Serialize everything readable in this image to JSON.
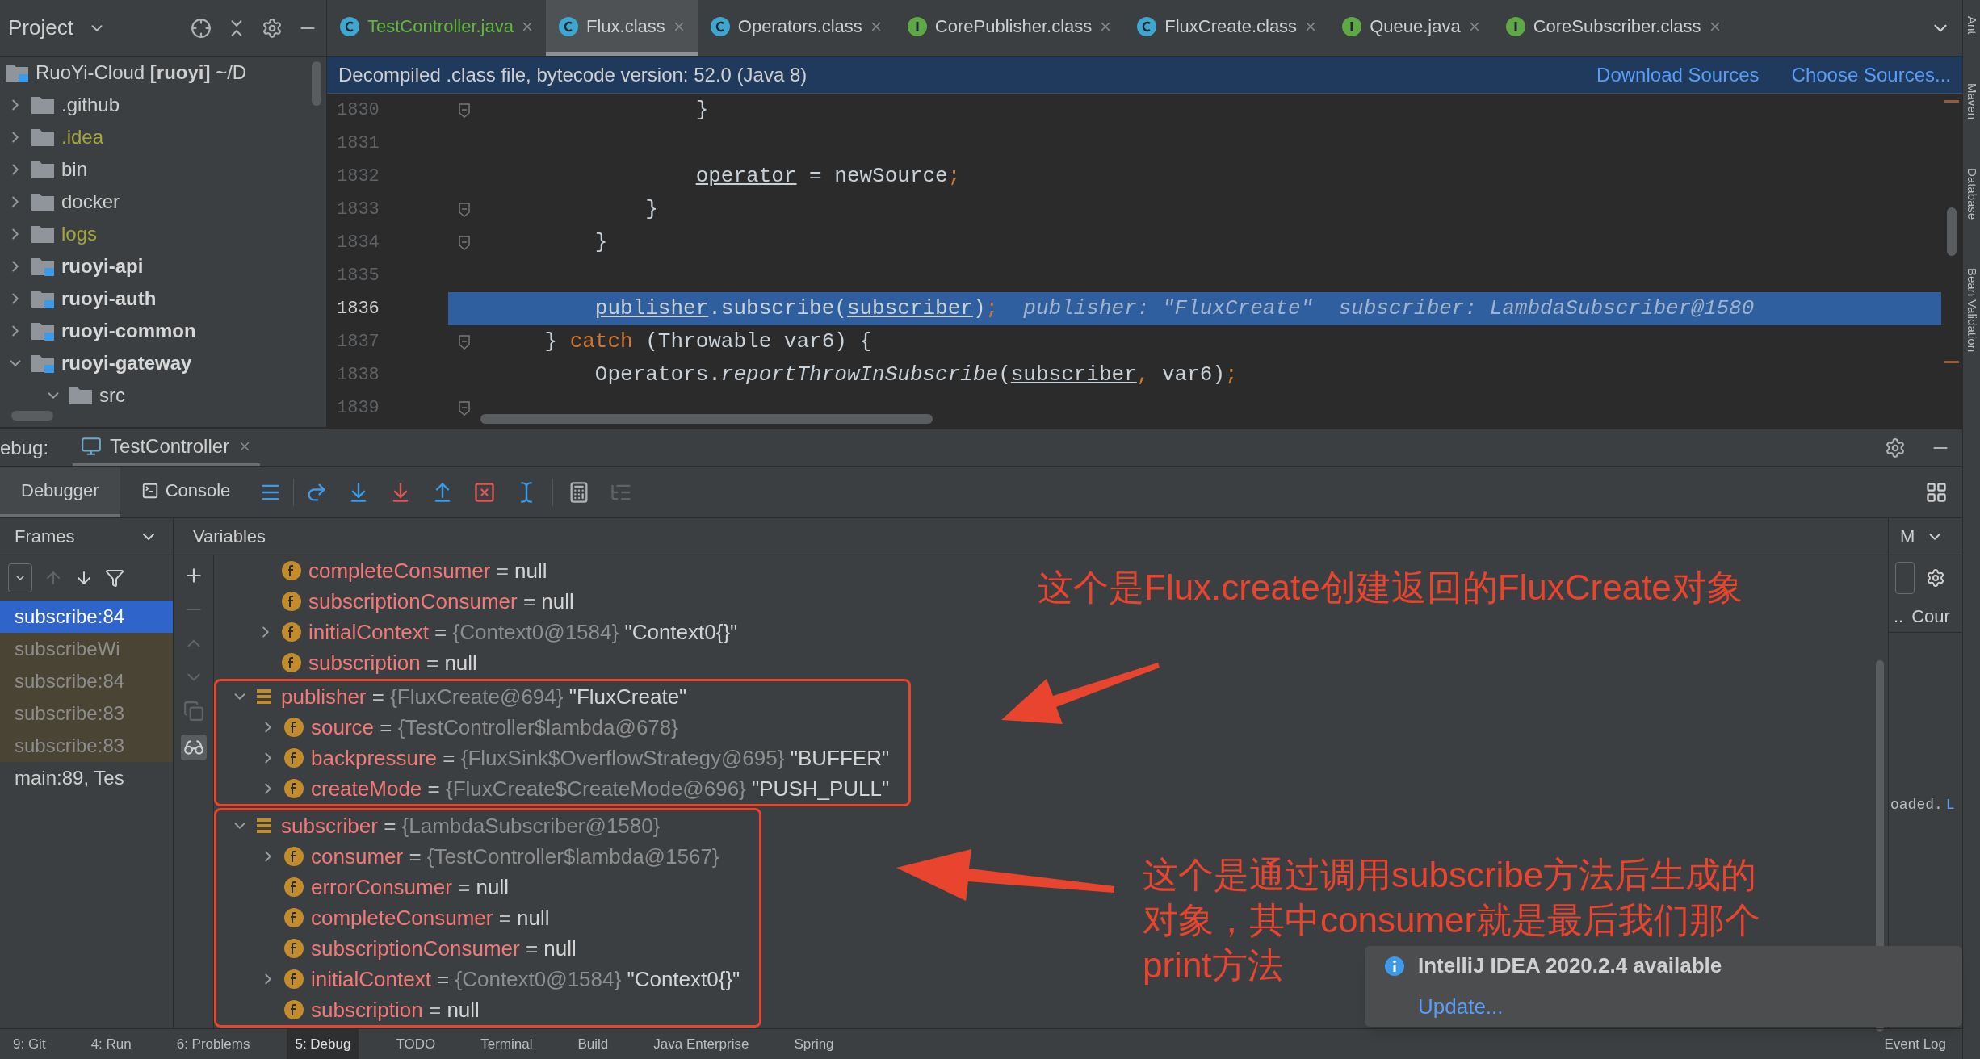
{
  "project_panel": {
    "title": "Project",
    "tree": [
      {
        "label": "RuoYi-Cloud **[ruoyi]** ~/D",
        "kind": "project",
        "children": [
          {
            "label": ".github",
            "kind": "folder",
            "expanded": false
          },
          {
            "label": ".idea",
            "kind": "ignored",
            "expanded": false
          },
          {
            "label": "bin",
            "kind": "folder",
            "expanded": false
          },
          {
            "label": "docker",
            "kind": "folder",
            "expanded": false
          },
          {
            "label": "logs",
            "kind": "ignored",
            "expanded": false
          },
          {
            "label": "ruoyi-api",
            "kind": "module",
            "expanded": false
          },
          {
            "label": "ruoyi-auth",
            "kind": "module",
            "expanded": false
          },
          {
            "label": "ruoyi-common",
            "kind": "module",
            "expanded": false
          },
          {
            "label": "ruoyi-gateway",
            "kind": "module",
            "expanded": true,
            "children": [
              {
                "label": "src",
                "kind": "folder",
                "expanded": true
              }
            ]
          }
        ]
      }
    ]
  },
  "editor": {
    "tabs": [
      {
        "label": "TestController.java",
        "kind": "class",
        "added": true,
        "selected": false
      },
      {
        "label": "Flux.class",
        "kind": "class",
        "added": false,
        "selected": true
      },
      {
        "label": "Operators.class",
        "kind": "class",
        "added": false,
        "selected": false
      },
      {
        "label": "CorePublisher.class",
        "kind": "interface",
        "added": false,
        "selected": false
      },
      {
        "label": "FluxCreate.class",
        "kind": "class",
        "added": false,
        "selected": false
      },
      {
        "label": "Queue.java",
        "kind": "interface",
        "added": false,
        "selected": false
      },
      {
        "label": "CoreSubscriber.class",
        "kind": "interface",
        "added": false,
        "selected": false
      }
    ],
    "banner": {
      "text": "Decompiled .class file, bytecode version: 52.0 (Java 8)",
      "links": [
        "Download Sources",
        "Choose Sources..."
      ]
    },
    "lines": [
      {
        "number": "1830",
        "fold": true,
        "selected": false,
        "segments": [
          {
            "text": "                }",
            "kind": "plain"
          }
        ]
      },
      {
        "number": "1831",
        "fold": false,
        "selected": false
      },
      {
        "number": "1832",
        "fold": false,
        "selected": false,
        "segments": [
          {
            "text": "                operator",
            "kind": "field"
          },
          {
            "text": " = newSource",
            "kind": "plain"
          },
          {
            "text": ";",
            "kind": "punct"
          }
        ]
      },
      {
        "number": "1833",
        "fold": true,
        "selected": false,
        "segments": [
          {
            "text": "            }",
            "kind": "plain"
          }
        ]
      },
      {
        "number": "1834",
        "fold": true,
        "selected": false,
        "segments": [
          {
            "text": "        }",
            "kind": "plain"
          }
        ]
      },
      {
        "number": "1835",
        "fold": false,
        "selected": false
      },
      {
        "number": "1836",
        "fold": false,
        "selected": true,
        "segments": [
          {
            "text": "        publisher",
            "kind": "field"
          },
          {
            "text": ".subscribe(",
            "kind": "plain"
          },
          {
            "text": "subscriber",
            "kind": "field"
          },
          {
            "text": ")",
            "kind": "plain"
          },
          {
            "text": ";",
            "kind": "punct"
          },
          {
            "text": "  publisher: \"FluxCreate\"  subscriber: LambdaSubscriber@1580",
            "kind": "hint"
          }
        ]
      },
      {
        "number": "1837",
        "fold": true,
        "selected": false,
        "segments": [
          {
            "text": "    } ",
            "kind": "plain"
          },
          {
            "text": "catch",
            "kind": "keyword"
          },
          {
            "text": " (Throwable var6) {",
            "kind": "plain"
          }
        ]
      },
      {
        "number": "1838",
        "fold": false,
        "selected": false,
        "segments": [
          {
            "text": "        Operators.",
            "kind": "plain"
          },
          {
            "text": "reportThrowInSubscribe",
            "kind": "italic"
          },
          {
            "text": "(",
            "kind": "plain"
          },
          {
            "text": "subscriber",
            "kind": "field"
          },
          {
            "text": ",",
            "kind": "punct"
          },
          {
            "text": " var6)",
            "kind": "plain"
          },
          {
            "text": ";",
            "kind": "punct"
          }
        ]
      },
      {
        "number": "1839",
        "fold": true,
        "selected": false
      }
    ]
  },
  "side_strip": [
    "Ant",
    "Maven",
    "Database",
    "Bean Validation"
  ],
  "debug": {
    "label": "ebug:",
    "session_tab": "TestController",
    "tabs": [
      {
        "label": "Debugger",
        "selected": true
      },
      {
        "label": "Console",
        "selected": false
      }
    ],
    "frames": {
      "title": "Frames",
      "items": [
        {
          "label": "subscribe:84",
          "library": false,
          "selected": true
        },
        {
          "label": "subscribeWi",
          "library": true,
          "selected": false
        },
        {
          "label": "subscribe:84",
          "library": true,
          "selected": false
        },
        {
          "label": "subscribe:83",
          "library": true,
          "selected": false
        },
        {
          "label": "subscribe:83",
          "library": true,
          "selected": false
        },
        {
          "label": "main:89, Tes",
          "library": false,
          "selected": false
        }
      ]
    },
    "variables": {
      "title": "Variables",
      "continued": [
        {
          "name": "completeConsumer",
          "kind": "field",
          "sep": "=",
          "value": "null"
        },
        {
          "name": "subscriptionConsumer",
          "kind": "field",
          "sep": "=",
          "value": "null"
        },
        {
          "name": "initialContext",
          "kind": "field",
          "sep": "=",
          "type": "{Context0@1584}",
          "value": "\"Context0{}\"",
          "expanded": false
        },
        {
          "name": "subscription",
          "kind": "field",
          "sep": "=",
          "value": "null"
        }
      ],
      "items": [
        {
          "name": "publisher",
          "kind": "object",
          "sep": "=",
          "type": "{FluxCreate@694}",
          "value": "\"FluxCreate\"",
          "expanded": true,
          "highlighted": true,
          "children": [
            {
              "name": "source",
              "kind": "field",
              "sep": "=",
              "type": "{TestController$lambda@678}",
              "expanded": false
            },
            {
              "name": "backpressure",
              "kind": "field",
              "sep": "=",
              "type": "{FluxSink$OverflowStrategy@695}",
              "value": "\"BUFFER\"",
              "expanded": false
            },
            {
              "name": "createMode",
              "kind": "field",
              "sep": "=",
              "type": "{FluxCreate$CreateMode@696}",
              "value": "\"PUSH_PULL\"",
              "expanded": false
            }
          ]
        },
        {
          "name": "subscriber",
          "kind": "object",
          "sep": "=",
          "type": "{LambdaSubscriber@1580}",
          "expanded": true,
          "highlighted": true,
          "children": [
            {
              "name": "consumer",
              "kind": "field",
              "sep": "=",
              "type": "{TestController$lambda@1567}",
              "expanded": false
            },
            {
              "name": "errorConsumer",
              "kind": "field",
              "sep": "=",
              "value": "null"
            },
            {
              "name": "completeConsumer",
              "kind": "field",
              "sep": "=",
              "value": "null"
            },
            {
              "name": "subscriptionConsumer",
              "kind": "field",
              "sep": "=",
              "value": "null"
            },
            {
              "name": "initialContext",
              "kind": "field",
              "sep": "=",
              "type": "{Context0@1584}",
              "value": "\"Context0{}\"",
              "expanded": false
            },
            {
              "name": "subscription",
              "kind": "field",
              "sep": "=",
              "value": "null"
            }
          ]
        }
      ]
    },
    "side_panel": {
      "title": "M",
      "row": [
        "..",
        "Cour"
      ],
      "console_text": "oaded.",
      "console_link": "L"
    }
  },
  "annotations": [
    {
      "lines": [
        "这个是Flux.create创建返回的FluxCreate对象"
      ]
    },
    {
      "lines": [
        "这个是通过调用subscribe方法后生成的",
        "对象，其中consumer就是最后我们那个",
        "print方法"
      ]
    }
  ],
  "notification": {
    "title": "IntelliJ IDEA 2020.2.4 available",
    "link": "Update..."
  },
  "tool_windows": [
    {
      "label": "9: Git",
      "selected": false
    },
    {
      "label": "4: Run",
      "selected": false
    },
    {
      "label": "6: Problems",
      "selected": false
    },
    {
      "label": "5: Debug",
      "selected": true
    },
    {
      "label": "TODO",
      "selected": false
    },
    {
      "label": "Terminal",
      "selected": false
    },
    {
      "label": "Build",
      "selected": false
    },
    {
      "label": "Java Enterprise",
      "selected": false
    },
    {
      "label": "Spring",
      "selected": false
    }
  ],
  "event_log": "Event Log"
}
